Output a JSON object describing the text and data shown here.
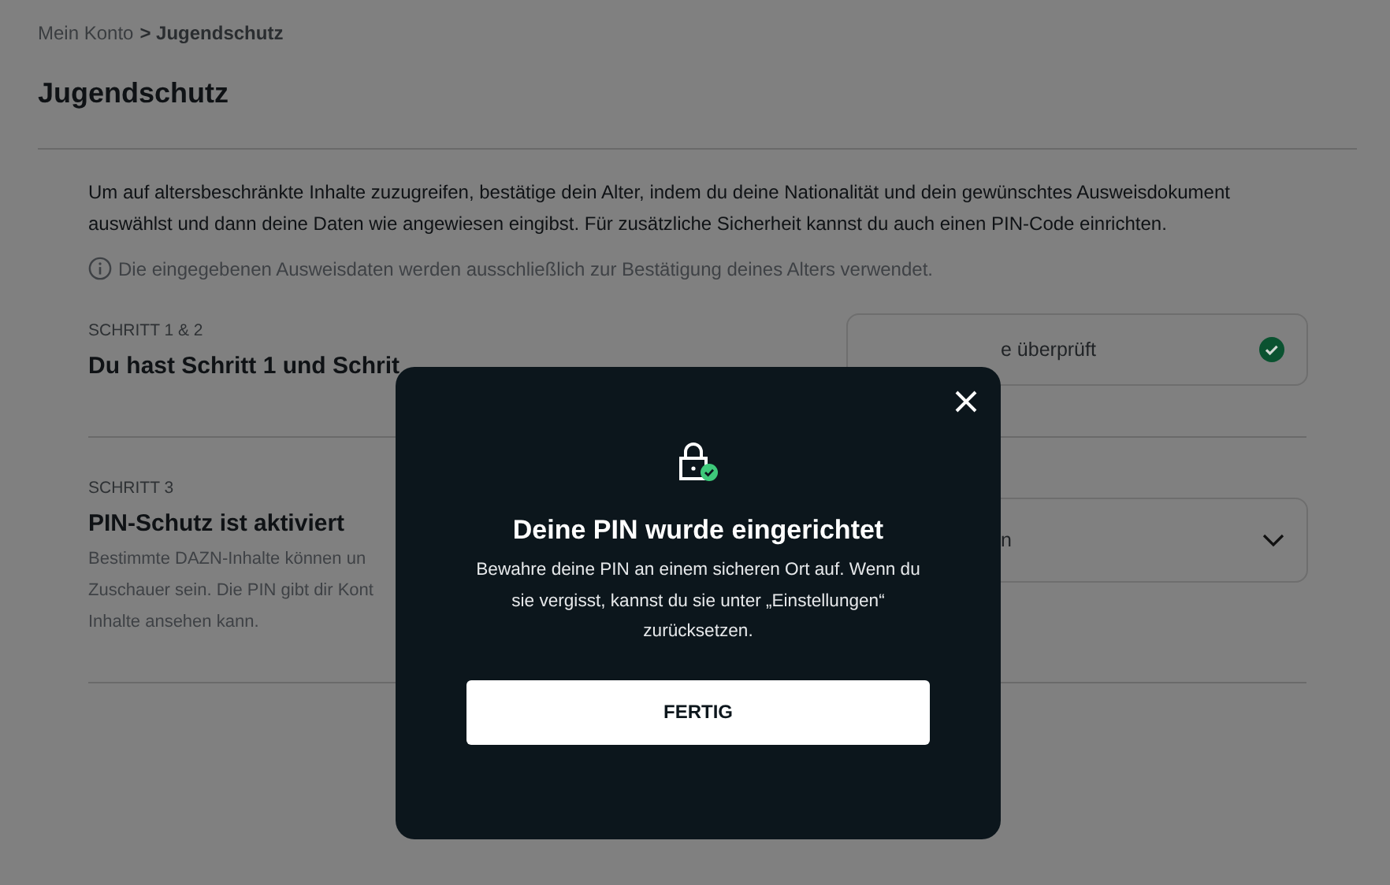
{
  "breadcrumb": [
    {
      "label": "Mein Konto",
      "current": false
    },
    {
      "label": "> Jugendschutz",
      "current": true
    }
  ],
  "title": "Jugendschutz",
  "intro": "Um auf altersbeschränkte Inhalte zuzugreifen, bestätige dein Alter, indem du deine Nationalität und dein gewünschtes Ausweisdokument auswählst und dann deine Daten wie angewiesen eingibst. Für zusätzliche Sicherheit kannst du auch einen PIN-Code einrichten.",
  "info_note": "Die eingegebenen Ausweisdaten werden ausschließlich zur Bestätigung deines Alters verwendet.",
  "steps": [
    {
      "label": "SCHRITT 1 & 2",
      "heading": "Du hast Schritt 1 und Schrit",
      "card": {
        "kind": "status",
        "text": "e überprüft",
        "checked": true
      }
    },
    {
      "label": "SCHRITT 3",
      "heading": "PIN-Schutz ist aktiviert",
      "description_lines": [
        "Bestimmte DAZN-Inhalte können un",
        "Zuschauer sein. Die PIN gibt dir Kont",
        "Inhalte ansehen kann."
      ],
      "card": {
        "kind": "dropdown",
        "text": "n",
        "expanded": false
      }
    }
  ],
  "modal": {
    "title": "Deine PIN wurde eingerichtet",
    "body": "Bewahre deine PIN an einem sicheren Ort auf. Wenn du sie vergisst, kannst du sie unter „Einstellungen“ zurücksetzen.",
    "button": "FERTIG"
  }
}
